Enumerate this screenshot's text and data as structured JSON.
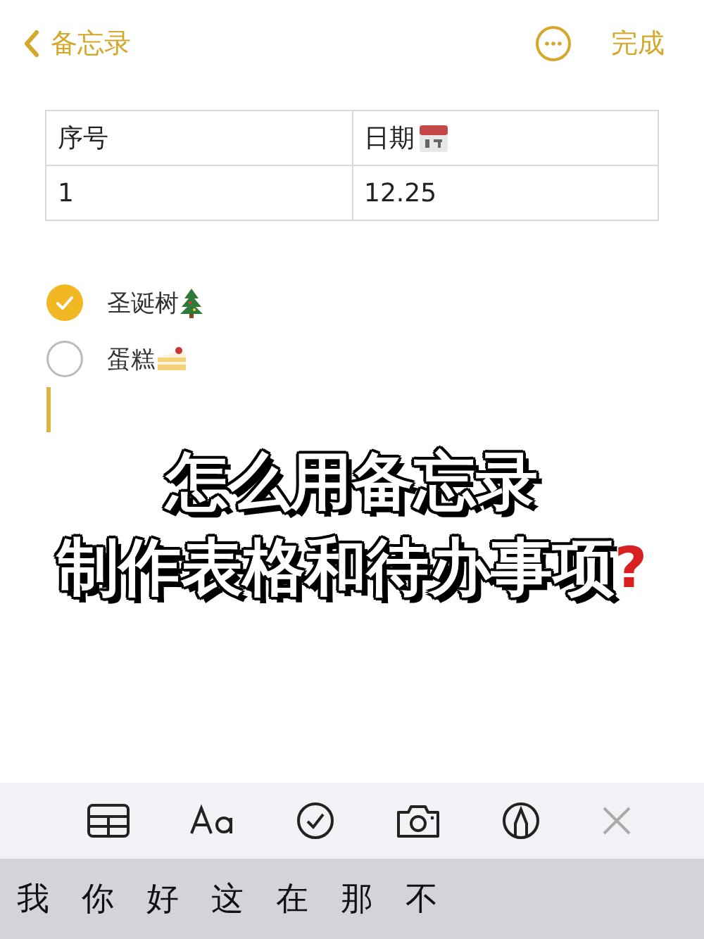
{
  "nav": {
    "back": "备忘录",
    "done": "完成"
  },
  "table": {
    "columns": [
      "序号",
      "日期"
    ],
    "rows": [
      [
        "1",
        "12.25"
      ]
    ]
  },
  "checklist": [
    {
      "text": "圣诞树",
      "checked": true,
      "kind": "tree"
    },
    {
      "text": "蛋糕",
      "checked": false,
      "kind": "cake"
    }
  ],
  "overlay_title": {
    "lines": [
      "怎么用备忘录",
      "制作表格和待办事项"
    ],
    "mark": "?"
  },
  "keyboard": {
    "candidates": [
      "我",
      "你",
      "好",
      "这",
      "在",
      "那",
      "不"
    ]
  }
}
